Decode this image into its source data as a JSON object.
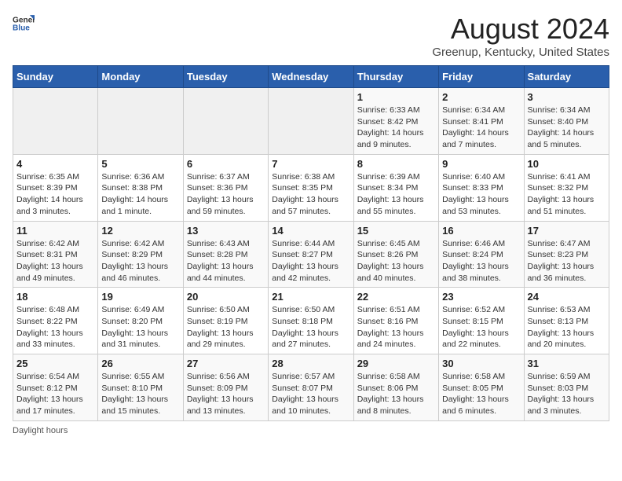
{
  "header": {
    "logo_general": "General",
    "logo_blue": "Blue",
    "main_title": "August 2024",
    "subtitle": "Greenup, Kentucky, United States"
  },
  "calendar": {
    "days_of_week": [
      "Sunday",
      "Monday",
      "Tuesday",
      "Wednesday",
      "Thursday",
      "Friday",
      "Saturday"
    ],
    "weeks": [
      [
        {
          "day": "",
          "info": ""
        },
        {
          "day": "",
          "info": ""
        },
        {
          "day": "",
          "info": ""
        },
        {
          "day": "",
          "info": ""
        },
        {
          "day": "1",
          "info": "Sunrise: 6:33 AM\nSunset: 8:42 PM\nDaylight: 14 hours and 9 minutes."
        },
        {
          "day": "2",
          "info": "Sunrise: 6:34 AM\nSunset: 8:41 PM\nDaylight: 14 hours and 7 minutes."
        },
        {
          "day": "3",
          "info": "Sunrise: 6:34 AM\nSunset: 8:40 PM\nDaylight: 14 hours and 5 minutes."
        }
      ],
      [
        {
          "day": "4",
          "info": "Sunrise: 6:35 AM\nSunset: 8:39 PM\nDaylight: 14 hours and 3 minutes."
        },
        {
          "day": "5",
          "info": "Sunrise: 6:36 AM\nSunset: 8:38 PM\nDaylight: 14 hours and 1 minute."
        },
        {
          "day": "6",
          "info": "Sunrise: 6:37 AM\nSunset: 8:36 PM\nDaylight: 13 hours and 59 minutes."
        },
        {
          "day": "7",
          "info": "Sunrise: 6:38 AM\nSunset: 8:35 PM\nDaylight: 13 hours and 57 minutes."
        },
        {
          "day": "8",
          "info": "Sunrise: 6:39 AM\nSunset: 8:34 PM\nDaylight: 13 hours and 55 minutes."
        },
        {
          "day": "9",
          "info": "Sunrise: 6:40 AM\nSunset: 8:33 PM\nDaylight: 13 hours and 53 minutes."
        },
        {
          "day": "10",
          "info": "Sunrise: 6:41 AM\nSunset: 8:32 PM\nDaylight: 13 hours and 51 minutes."
        }
      ],
      [
        {
          "day": "11",
          "info": "Sunrise: 6:42 AM\nSunset: 8:31 PM\nDaylight: 13 hours and 49 minutes."
        },
        {
          "day": "12",
          "info": "Sunrise: 6:42 AM\nSunset: 8:29 PM\nDaylight: 13 hours and 46 minutes."
        },
        {
          "day": "13",
          "info": "Sunrise: 6:43 AM\nSunset: 8:28 PM\nDaylight: 13 hours and 44 minutes."
        },
        {
          "day": "14",
          "info": "Sunrise: 6:44 AM\nSunset: 8:27 PM\nDaylight: 13 hours and 42 minutes."
        },
        {
          "day": "15",
          "info": "Sunrise: 6:45 AM\nSunset: 8:26 PM\nDaylight: 13 hours and 40 minutes."
        },
        {
          "day": "16",
          "info": "Sunrise: 6:46 AM\nSunset: 8:24 PM\nDaylight: 13 hours and 38 minutes."
        },
        {
          "day": "17",
          "info": "Sunrise: 6:47 AM\nSunset: 8:23 PM\nDaylight: 13 hours and 36 minutes."
        }
      ],
      [
        {
          "day": "18",
          "info": "Sunrise: 6:48 AM\nSunset: 8:22 PM\nDaylight: 13 hours and 33 minutes."
        },
        {
          "day": "19",
          "info": "Sunrise: 6:49 AM\nSunset: 8:20 PM\nDaylight: 13 hours and 31 minutes."
        },
        {
          "day": "20",
          "info": "Sunrise: 6:50 AM\nSunset: 8:19 PM\nDaylight: 13 hours and 29 minutes."
        },
        {
          "day": "21",
          "info": "Sunrise: 6:50 AM\nSunset: 8:18 PM\nDaylight: 13 hours and 27 minutes."
        },
        {
          "day": "22",
          "info": "Sunrise: 6:51 AM\nSunset: 8:16 PM\nDaylight: 13 hours and 24 minutes."
        },
        {
          "day": "23",
          "info": "Sunrise: 6:52 AM\nSunset: 8:15 PM\nDaylight: 13 hours and 22 minutes."
        },
        {
          "day": "24",
          "info": "Sunrise: 6:53 AM\nSunset: 8:13 PM\nDaylight: 13 hours and 20 minutes."
        }
      ],
      [
        {
          "day": "25",
          "info": "Sunrise: 6:54 AM\nSunset: 8:12 PM\nDaylight: 13 hours and 17 minutes."
        },
        {
          "day": "26",
          "info": "Sunrise: 6:55 AM\nSunset: 8:10 PM\nDaylight: 13 hours and 15 minutes."
        },
        {
          "day": "27",
          "info": "Sunrise: 6:56 AM\nSunset: 8:09 PM\nDaylight: 13 hours and 13 minutes."
        },
        {
          "day": "28",
          "info": "Sunrise: 6:57 AM\nSunset: 8:07 PM\nDaylight: 13 hours and 10 minutes."
        },
        {
          "day": "29",
          "info": "Sunrise: 6:58 AM\nSunset: 8:06 PM\nDaylight: 13 hours and 8 minutes."
        },
        {
          "day": "30",
          "info": "Sunrise: 6:58 AM\nSunset: 8:05 PM\nDaylight: 13 hours and 6 minutes."
        },
        {
          "day": "31",
          "info": "Sunrise: 6:59 AM\nSunset: 8:03 PM\nDaylight: 13 hours and 3 minutes."
        }
      ]
    ]
  },
  "footer": {
    "daylight_label": "Daylight hours"
  }
}
